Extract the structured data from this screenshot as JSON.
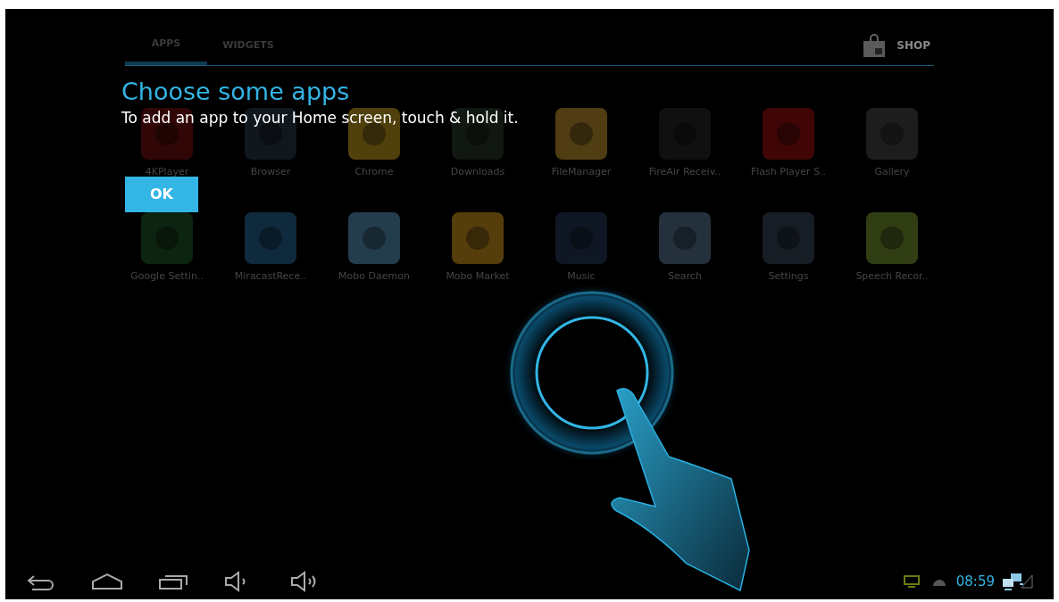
{
  "tabs": [
    {
      "label": "APPS",
      "selected": true
    },
    {
      "label": "WIDGETS",
      "selected": false
    }
  ],
  "shop": {
    "label": "SHOP"
  },
  "coach": {
    "title": "Choose some apps",
    "body": "To add an app to your Home screen, touch & hold it.",
    "button": "OK"
  },
  "apps": [
    {
      "label": "4KPlayer"
    },
    {
      "label": "Browser"
    },
    {
      "label": "Chrome"
    },
    {
      "label": "Downloads"
    },
    {
      "label": "FileManager"
    },
    {
      "label": "FireAir Receiv.."
    },
    {
      "label": "Flash Player S.."
    },
    {
      "label": "Gallery"
    },
    {
      "label": "Google Settin.."
    },
    {
      "label": "MiracastRece.."
    },
    {
      "label": "Mobo Daemon"
    },
    {
      "label": "Mobo Market"
    },
    {
      "label": "Music"
    },
    {
      "label": "Search"
    },
    {
      "label": "Settings"
    },
    {
      "label": "Speech Recor.."
    }
  ],
  "status_bar": {
    "time": "08:59"
  }
}
